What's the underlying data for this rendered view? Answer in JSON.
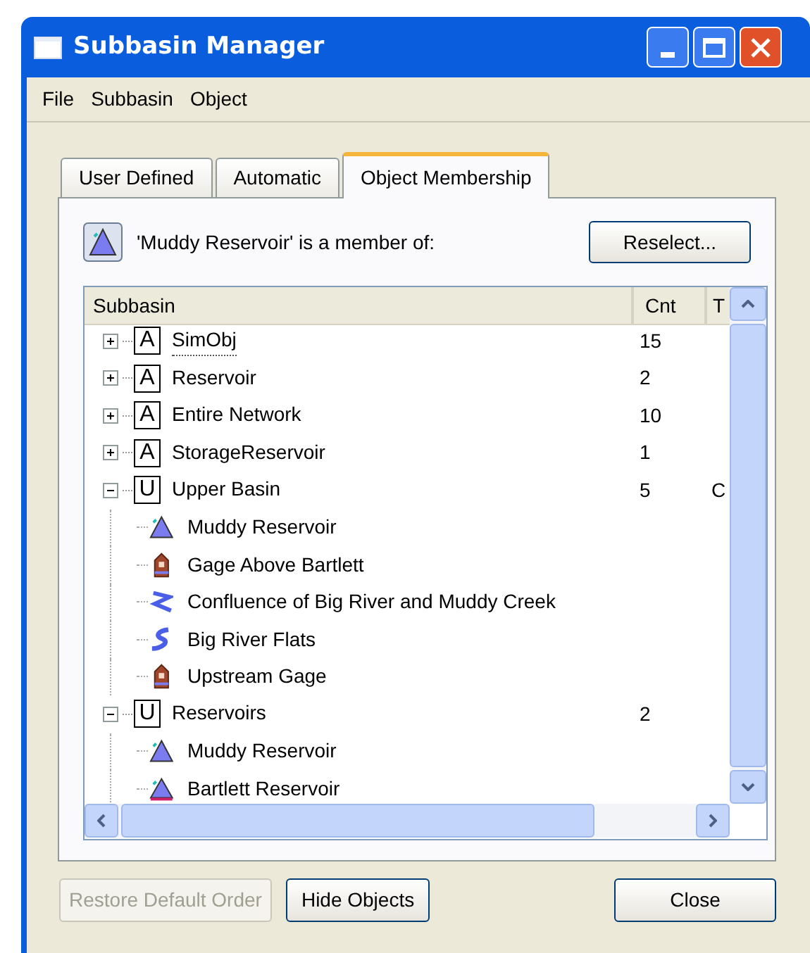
{
  "window": {
    "title": "Subbasin Manager"
  },
  "menu": [
    "File",
    "Subbasin",
    "Object"
  ],
  "tabs": [
    {
      "label": "User Defined",
      "selected": false
    },
    {
      "label": "Automatic",
      "selected": false
    },
    {
      "label": "Object Membership",
      "selected": true
    }
  ],
  "membership": {
    "text": "'Muddy Reservoir' is a member of:",
    "button": "Reselect..."
  },
  "tree": {
    "columns": [
      "Subbasin",
      "Cnt",
      "T"
    ],
    "rows": [
      {
        "kind": "group",
        "badge": "A",
        "name": "SimObj",
        "cnt": "15",
        "expanded": false,
        "focused": true
      },
      {
        "kind": "group",
        "badge": "A",
        "name": "Reservoir",
        "cnt": "2",
        "expanded": false,
        "focused": false
      },
      {
        "kind": "group",
        "badge": "A",
        "name": "Entire Network",
        "cnt": "10",
        "expanded": false,
        "focused": false
      },
      {
        "kind": "group",
        "badge": "A",
        "name": "StorageReservoir",
        "cnt": "1",
        "expanded": false,
        "focused": false
      },
      {
        "kind": "group",
        "badge": "U",
        "name": "Upper Basin",
        "cnt": "5",
        "column_3": "C",
        "expanded": true,
        "focused": false,
        "children": [
          {
            "kind": "reservoir",
            "name": "Muddy Reservoir"
          },
          {
            "kind": "gage",
            "name": "Gage Above Bartlett"
          },
          {
            "kind": "junction",
            "name": "Confluence of Big River and Muddy Creek"
          },
          {
            "kind": "reach",
            "name": "Big River Flats"
          },
          {
            "kind": "gage",
            "name": "Upstream Gage"
          }
        ]
      },
      {
        "kind": "group",
        "badge": "U",
        "name": "Reservoirs",
        "cnt": "2",
        "expanded": true,
        "focused": false,
        "children": [
          {
            "kind": "reservoir",
            "name": "Muddy Reservoir"
          },
          {
            "kind": "storage",
            "name": "Bartlett Reservoir"
          }
        ]
      }
    ]
  },
  "buttons": [
    {
      "label": "Restore Default Order",
      "disabled": true
    },
    {
      "label": "Hide Objects",
      "disabled": false
    },
    {
      "label": "Close",
      "disabled": false
    }
  ]
}
